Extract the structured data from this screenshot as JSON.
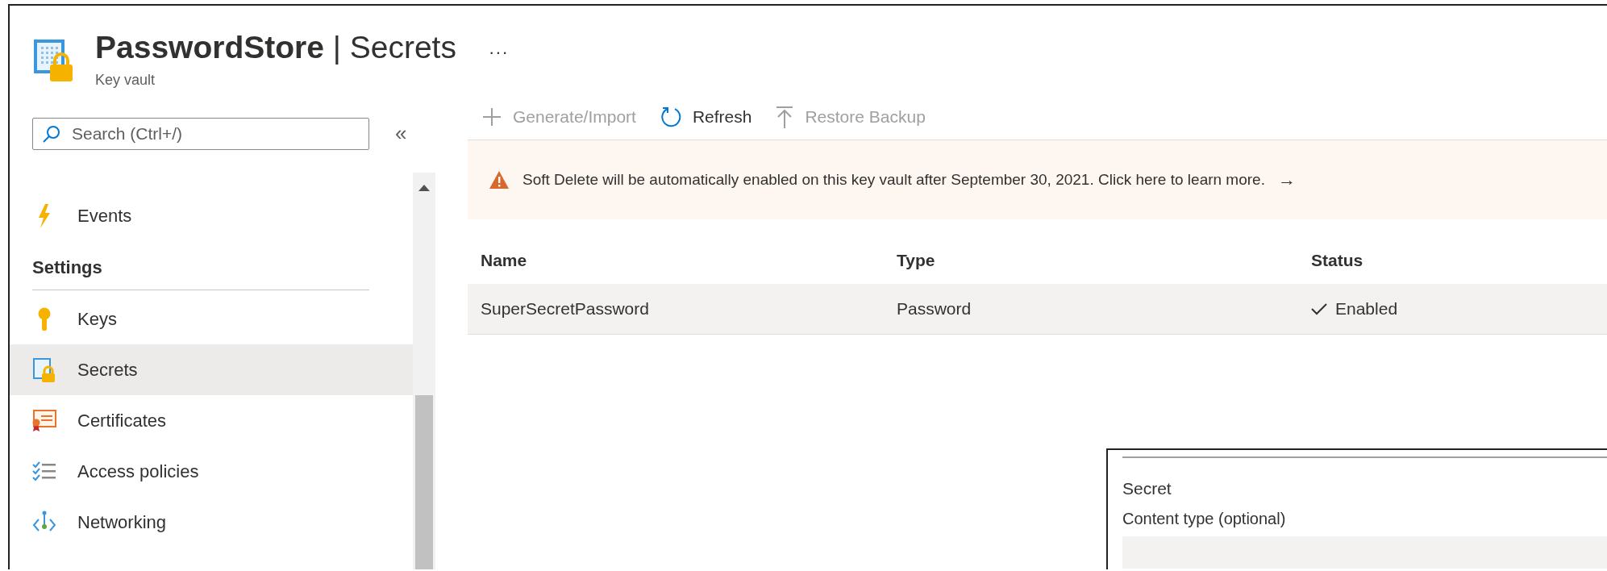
{
  "header": {
    "title": "**PasswordStore** | Secrets",
    "more": "···",
    "subtitle": "Key vault"
  },
  "sidebar": {
    "search": {
      "placeholder": "Search (Ctrl+/)"
    },
    "collapse": "«",
    "items": [
      {
        "label": "Events",
        "selected": false
      }
    ],
    "sections": [
      {
        "heading": "Settings",
        "items": [
          {
            "label": "Keys",
            "selected": false
          },
          {
            "label": "Secrets",
            "selected": true
          },
          {
            "label": "Certificates",
            "selected": false
          },
          {
            "label": "Access policies",
            "selected": false
          },
          {
            "label": "Networking",
            "selected": false
          }
        ]
      }
    ]
  },
  "toolbar": [
    {
      "label": "Generate/Import",
      "disabled": true
    },
    {
      "label": "Refresh",
      "disabled": false
    },
    {
      "label": "Restore Backup",
      "disabled": true
    }
  ],
  "banner": {
    "text": "Soft Delete will be automatically enabled on this key vault after September 30, 2021. Click here to learn more.",
    "arrow": "→"
  },
  "table": {
    "columns": [
      "Name",
      "Type",
      "Status"
    ],
    "rows": [
      {
        "selected": true,
        "cells": [
          "SuperSecretPassword",
          "Password",
          "Enabled"
        ]
      }
    ]
  },
  "panel": {
    "heading": "Secret",
    "field_label": "Content type (optional)"
  }
}
